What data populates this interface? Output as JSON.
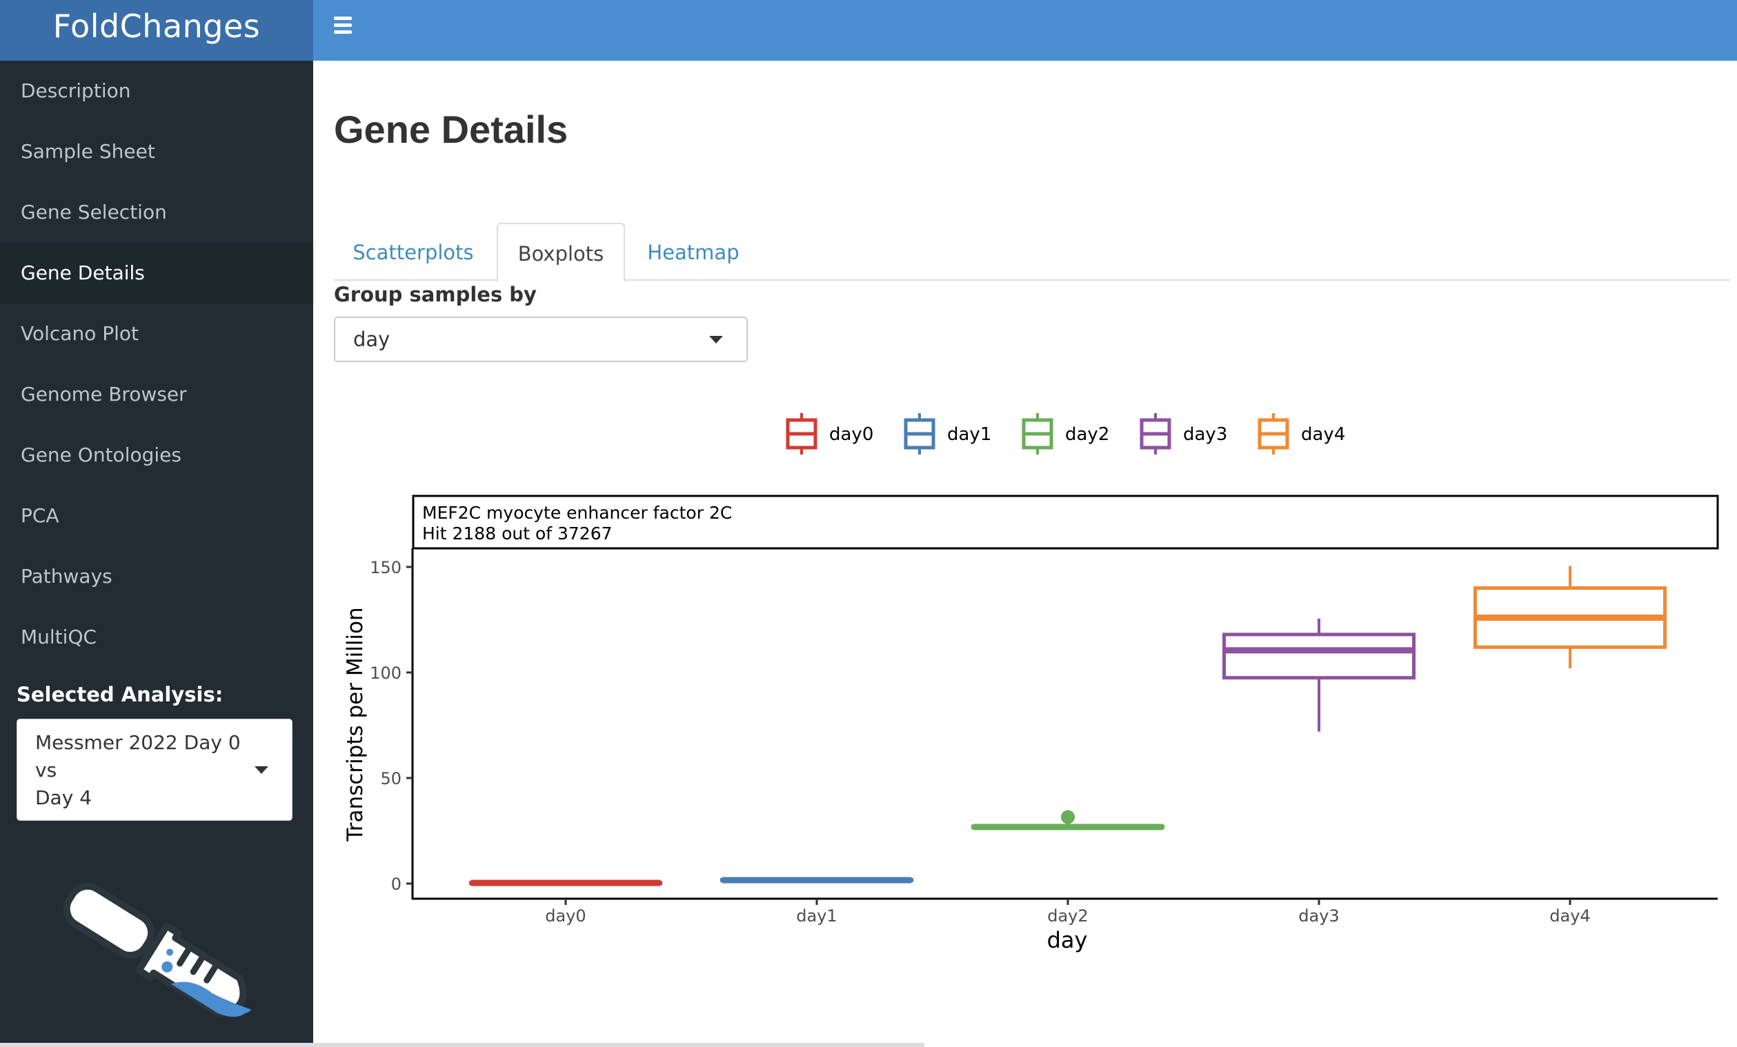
{
  "app": {
    "title": "FoldChanges"
  },
  "sidebar": {
    "items": [
      {
        "label": "Description",
        "active": false
      },
      {
        "label": "Sample Sheet",
        "active": false
      },
      {
        "label": "Gene Selection",
        "active": false
      },
      {
        "label": "Gene Details",
        "active": true
      },
      {
        "label": "Volcano Plot",
        "active": false
      },
      {
        "label": "Genome Browser",
        "active": false
      },
      {
        "label": "Gene Ontologies",
        "active": false
      },
      {
        "label": "PCA",
        "active": false
      },
      {
        "label": "Pathways",
        "active": false
      },
      {
        "label": "MultiQC",
        "active": false
      }
    ],
    "selected_analysis_label": "Selected Analysis:",
    "selected_analysis_value_line1": "Messmer 2022 Day 0 vs",
    "selected_analysis_value_line2": "Day 4"
  },
  "topbar": {
    "menu_icon": "hamburger-icon"
  },
  "main": {
    "page_title": "Gene Details",
    "tabs": [
      {
        "label": "Scatterplots",
        "active": false
      },
      {
        "label": "Boxplots",
        "active": true
      },
      {
        "label": "Heatmap",
        "active": false
      }
    ],
    "group_by_label": "Group samples by",
    "group_by_value": "day"
  },
  "chart_data": {
    "type": "box",
    "title": "MEF2C myocyte enhancer factor 2C",
    "subtitle": "Hit 2188 out of 37267",
    "xlabel": "day",
    "ylabel": "Transcripts per Million",
    "ylim": [
      -7,
      160
    ],
    "yticks": [
      0,
      50,
      100,
      150
    ],
    "grid": false,
    "legend": {
      "position": "top",
      "entries": [
        "day0",
        "day1",
        "day2",
        "day3",
        "day4"
      ]
    },
    "categories": [
      "day0",
      "day1",
      "day2",
      "day3",
      "day4"
    ],
    "colors": [
      "#d33a30",
      "#4a7db5",
      "#68ad57",
      "#8e52a0",
      "#ef8a33"
    ],
    "boxes": [
      {
        "name": "day0",
        "min": 0.1,
        "q1": 0.2,
        "median": 0.3,
        "q3": 0.4,
        "max": 0.5,
        "outliers": []
      },
      {
        "name": "day1",
        "min": 1.3,
        "q1": 1.5,
        "median": 1.6,
        "q3": 1.8,
        "max": 2.0,
        "outliers": []
      },
      {
        "name": "day2",
        "min": 26.3,
        "q1": 26.5,
        "median": 26.8,
        "q3": 27.1,
        "max": 27.3,
        "outliers": [
          31.5
        ]
      },
      {
        "name": "day3",
        "min": 72,
        "q1": 97.5,
        "median": 110.5,
        "q3": 118,
        "max": 125.5,
        "outliers": []
      },
      {
        "name": "day4",
        "min": 102,
        "q1": 112,
        "median": 126,
        "q3": 140,
        "max": 150.5,
        "outliers": []
      }
    ]
  }
}
